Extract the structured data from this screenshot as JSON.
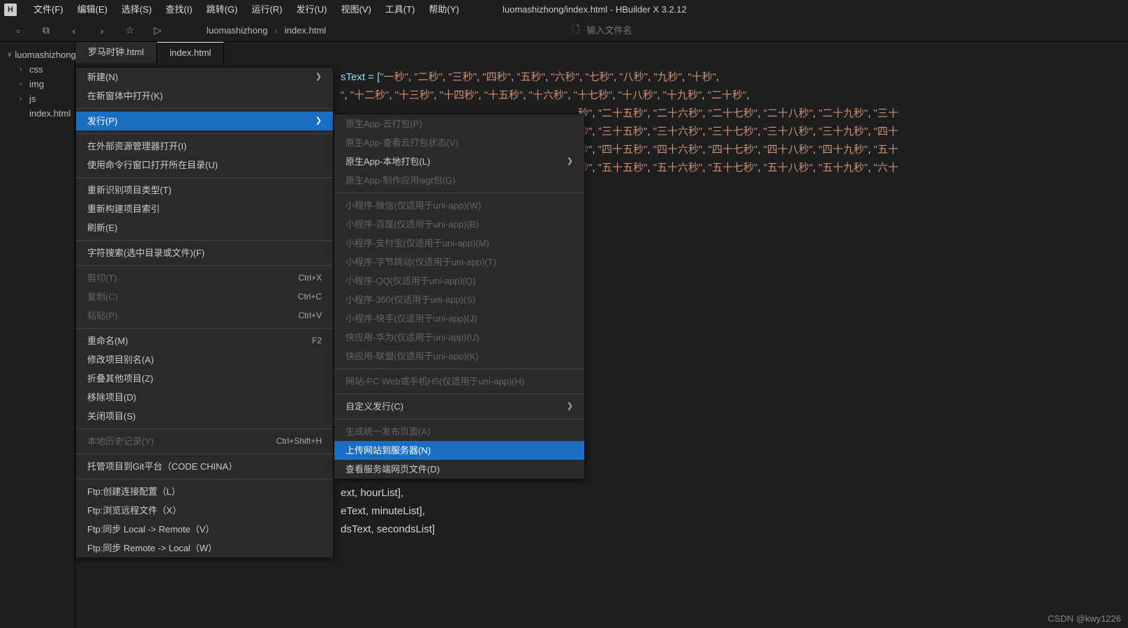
{
  "app": {
    "icon_letter": "H",
    "title": "luomashizhong/index.html - HBuilder X 3.2.12"
  },
  "menubar": [
    "文件(F)",
    "编辑(E)",
    "选择(S)",
    "查找(I)",
    "跳转(G)",
    "运行(R)",
    "发行(U)",
    "视图(V)",
    "工具(T)",
    "帮助(Y)"
  ],
  "breadcrumb": {
    "project": "luomashizhong",
    "file": "index.html"
  },
  "search": {
    "placeholder": "输入文件名"
  },
  "sidebar": {
    "root": "luomashizhong",
    "items": [
      "css",
      "img",
      "js",
      "index.html"
    ]
  },
  "tabs": [
    {
      "label": "罗马时钟.html",
      "active": false
    },
    {
      "label": "index.html",
      "active": true
    }
  ],
  "code": {
    "prefix": "sText = [",
    "line1": [
      "\"一秒\"",
      "\"二秒\"",
      "\"三秒\"",
      "\"四秒\"",
      "\"五秒\"",
      "\"六秒\"",
      "\"七秒\"",
      "\"八秒\"",
      "\"九秒\"",
      "\"十秒\""
    ],
    "line2a": "\"",
    "line2": [
      "\"十二秒\"",
      "\"十三秒\"",
      "\"十四秒\"",
      "\"十五秒\"",
      "\"十六秒\"",
      "\"十七秒\"",
      "\"十八秒\"",
      "\"十九秒\"",
      "\"二十秒\""
    ],
    "line3a": "秒\"",
    "line3": [
      "\"二十五秒\"",
      "\"二十六秒\"",
      "\"二十七秒\"",
      "\"二十八秒\"",
      "\"二十九秒\"",
      "\"三十"
    ],
    "line4a": "秒\"",
    "line4": [
      "\"三十五秒\"",
      "\"三十六秒\"",
      "\"三十七秒\"",
      "\"三十八秒\"",
      "\"三十九秒\"",
      "\"四十"
    ],
    "line5a": "秒\"",
    "line5": [
      "\"四十五秒\"",
      "\"四十六秒\"",
      "\"四十七秒\"",
      "\"四十八秒\"",
      "\"四十九秒\"",
      "\"五十"
    ],
    "line6a": "秒\"",
    "line6": [
      "\"五十五秒\"",
      "\"五十六秒\"",
      "\"五十七秒\"",
      "\"五十八秒\"",
      "\"五十九秒\"",
      "\"六十"
    ],
    "tail1": "ext, hourList],",
    "tail2": "eText, minuteList],",
    "tail3": "dsText, secondsList]"
  },
  "context_menu": {
    "groups": [
      [
        {
          "label": "新建(N)",
          "arrow": true
        },
        {
          "label": "在新窗体中打开(K)"
        }
      ],
      [
        {
          "label": "发行(P)",
          "arrow": true,
          "highlighted": true
        }
      ],
      [
        {
          "label": "在外部资源管理器打开(I)"
        },
        {
          "label": "使用命令行窗口打开所在目录(U)"
        }
      ],
      [
        {
          "label": "重新识别项目类型(T)"
        },
        {
          "label": "重新构建项目索引"
        },
        {
          "label": "刷新(E)"
        }
      ],
      [
        {
          "label": "字符搜索(选中目录或文件)(F)"
        }
      ],
      [
        {
          "label": "剪切(T)",
          "shortcut": "Ctrl+X",
          "disabled": true
        },
        {
          "label": "复制(C)",
          "shortcut": "Ctrl+C",
          "disabled": true
        },
        {
          "label": "粘贴(P)",
          "shortcut": "Ctrl+V",
          "disabled": true
        }
      ],
      [
        {
          "label": "重命名(M)",
          "shortcut": "F2"
        },
        {
          "label": "修改项目别名(A)"
        },
        {
          "label": "折叠其他项目(Z)"
        },
        {
          "label": "移除项目(D)"
        },
        {
          "label": "关闭项目(S)"
        }
      ],
      [
        {
          "label": "本地历史记录(Y)",
          "shortcut": "Ctrl+Shift+H",
          "disabled": true
        }
      ],
      [
        {
          "label": "托管项目到Git平台（CODE CHINA）"
        }
      ],
      [
        {
          "label": "Ftp:创建连接配置（L）"
        },
        {
          "label": "Ftp:浏览远程文件（X）"
        },
        {
          "label": "Ftp:同步 Local -> Remote（V）"
        },
        {
          "label": "Ftp:同步 Remote -> Local（W）"
        }
      ]
    ]
  },
  "submenu": {
    "groups": [
      [
        {
          "label": "原生App-云打包(P)",
          "disabled": true
        },
        {
          "label": "原生App-查看云打包状态(V)",
          "disabled": true
        },
        {
          "label": "原生App-本地打包(L)",
          "arrow": true
        },
        {
          "label": "原生App-制作应用wgt包(G)",
          "disabled": true
        }
      ],
      [
        {
          "label": "小程序-微信(仅适用于uni-app)(W)",
          "disabled": true
        },
        {
          "label": "小程序-百度(仅适用于uni-app)(B)",
          "disabled": true
        },
        {
          "label": "小程序-支付宝(仅适用于uni-app)(M)",
          "disabled": true
        },
        {
          "label": "小程序-字节跳动(仅适用于uni-app)(T)",
          "disabled": true
        },
        {
          "label": "小程序-QQ(仅适用于uni-app)(Q)",
          "disabled": true
        },
        {
          "label": "小程序-360(仅适用于uni-app)(S)",
          "disabled": true
        },
        {
          "label": "小程序-快手(仅适用于uni-app)(J)",
          "disabled": true
        },
        {
          "label": "快应用-华为(仅适用于uni-app)(U)",
          "disabled": true
        },
        {
          "label": "快应用-联盟(仅适用于uni-app)(K)",
          "disabled": true
        }
      ],
      [
        {
          "label": "网站-PC Web或手机H5(仅适用于uni-app)(H)",
          "disabled": true
        }
      ],
      [
        {
          "label": "自定义发行(C)",
          "arrow": true
        }
      ],
      [
        {
          "label": "生成统一发布页面(A)",
          "disabled": true
        },
        {
          "label": "上传网站到服务器(N)",
          "highlighted": true
        },
        {
          "label": "查看服务端网页文件(D)"
        }
      ]
    ]
  },
  "watermark": "CSDN @kwy1226"
}
